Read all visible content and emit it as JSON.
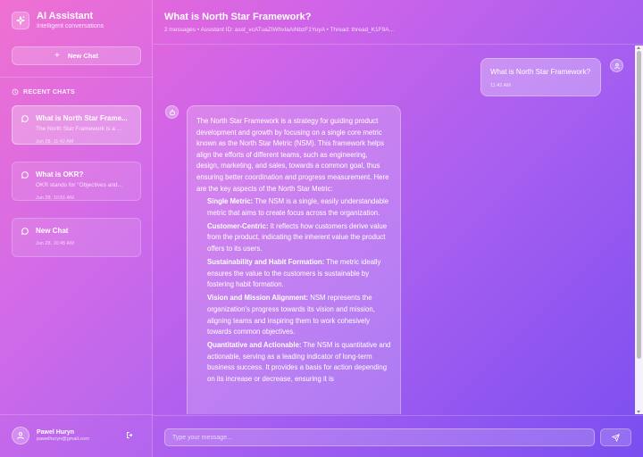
{
  "brand": {
    "title": "AI Assistant",
    "subtitle": "Intelligent conversations",
    "icon": "sparkle-icon"
  },
  "sidebar": {
    "new_chat_label": "New Chat",
    "recent_label": "RECENT CHATS",
    "chats": [
      {
        "title": "What is North Star Frame...",
        "preview": "The North Star Framework is a ...",
        "time": "Jun 28, 11:42 AM",
        "active": true
      },
      {
        "title": "What is OKR?",
        "preview": "OKR stands for \"Objectives and...",
        "time": "Jun 28, 10:51 AM",
        "active": false
      },
      {
        "title": "New Chat",
        "preview": "",
        "time": "Jun 28, 10:45 AM",
        "active": false
      }
    ]
  },
  "user": {
    "name": "Pawel Huryn",
    "email": "pawelhuryn@gmail.com"
  },
  "chat": {
    "title": "What is North Star Framework?",
    "meta": "2 messages • Assistant ID: asst_vcATuaZIWhvIaAiNbzF1YuyA • Thread: thread_K1F9A...",
    "user_message": {
      "text": "What is North Star Framework?",
      "time": "11:42 AM"
    },
    "assistant_message": {
      "intro": "The North Star Framework is a strategy for guiding product development and growth by focusing on a single core metric known as the North Star Metric (NSM). This framework helps align the efforts of different teams, such as engineering, design, marketing, and sales, towards a common goal, thus ensuring better coordination and progress measurement. Here are the key aspects of the North Star Metric:",
      "points": [
        {
          "title": "Single Metric:",
          "text": " The NSM is a single, easily understandable metric that aims to create focus across the organization."
        },
        {
          "title": "Customer-Centric:",
          "text": " It reflects how customers derive value from the product, indicating the inherent value the product offers to its users."
        },
        {
          "title": "Sustainability and Habit Formation:",
          "text": " The metric ideally ensures the value to the customers is sustainable by fostering habit formation."
        },
        {
          "title": "Vision and Mission Alignment:",
          "text": " NSM represents the organization's progress towards its vision and mission, aligning teams and inspiring them to work cohesively towards common objectives."
        },
        {
          "title": "Quantitative and Actionable:",
          "text": " The NSM is quantitative and actionable, serving as a leading indicator of long-term business success. It provides a basis for action depending on its increase or decrease, ensuring it is"
        }
      ]
    }
  },
  "input": {
    "placeholder": "Type your message..."
  }
}
